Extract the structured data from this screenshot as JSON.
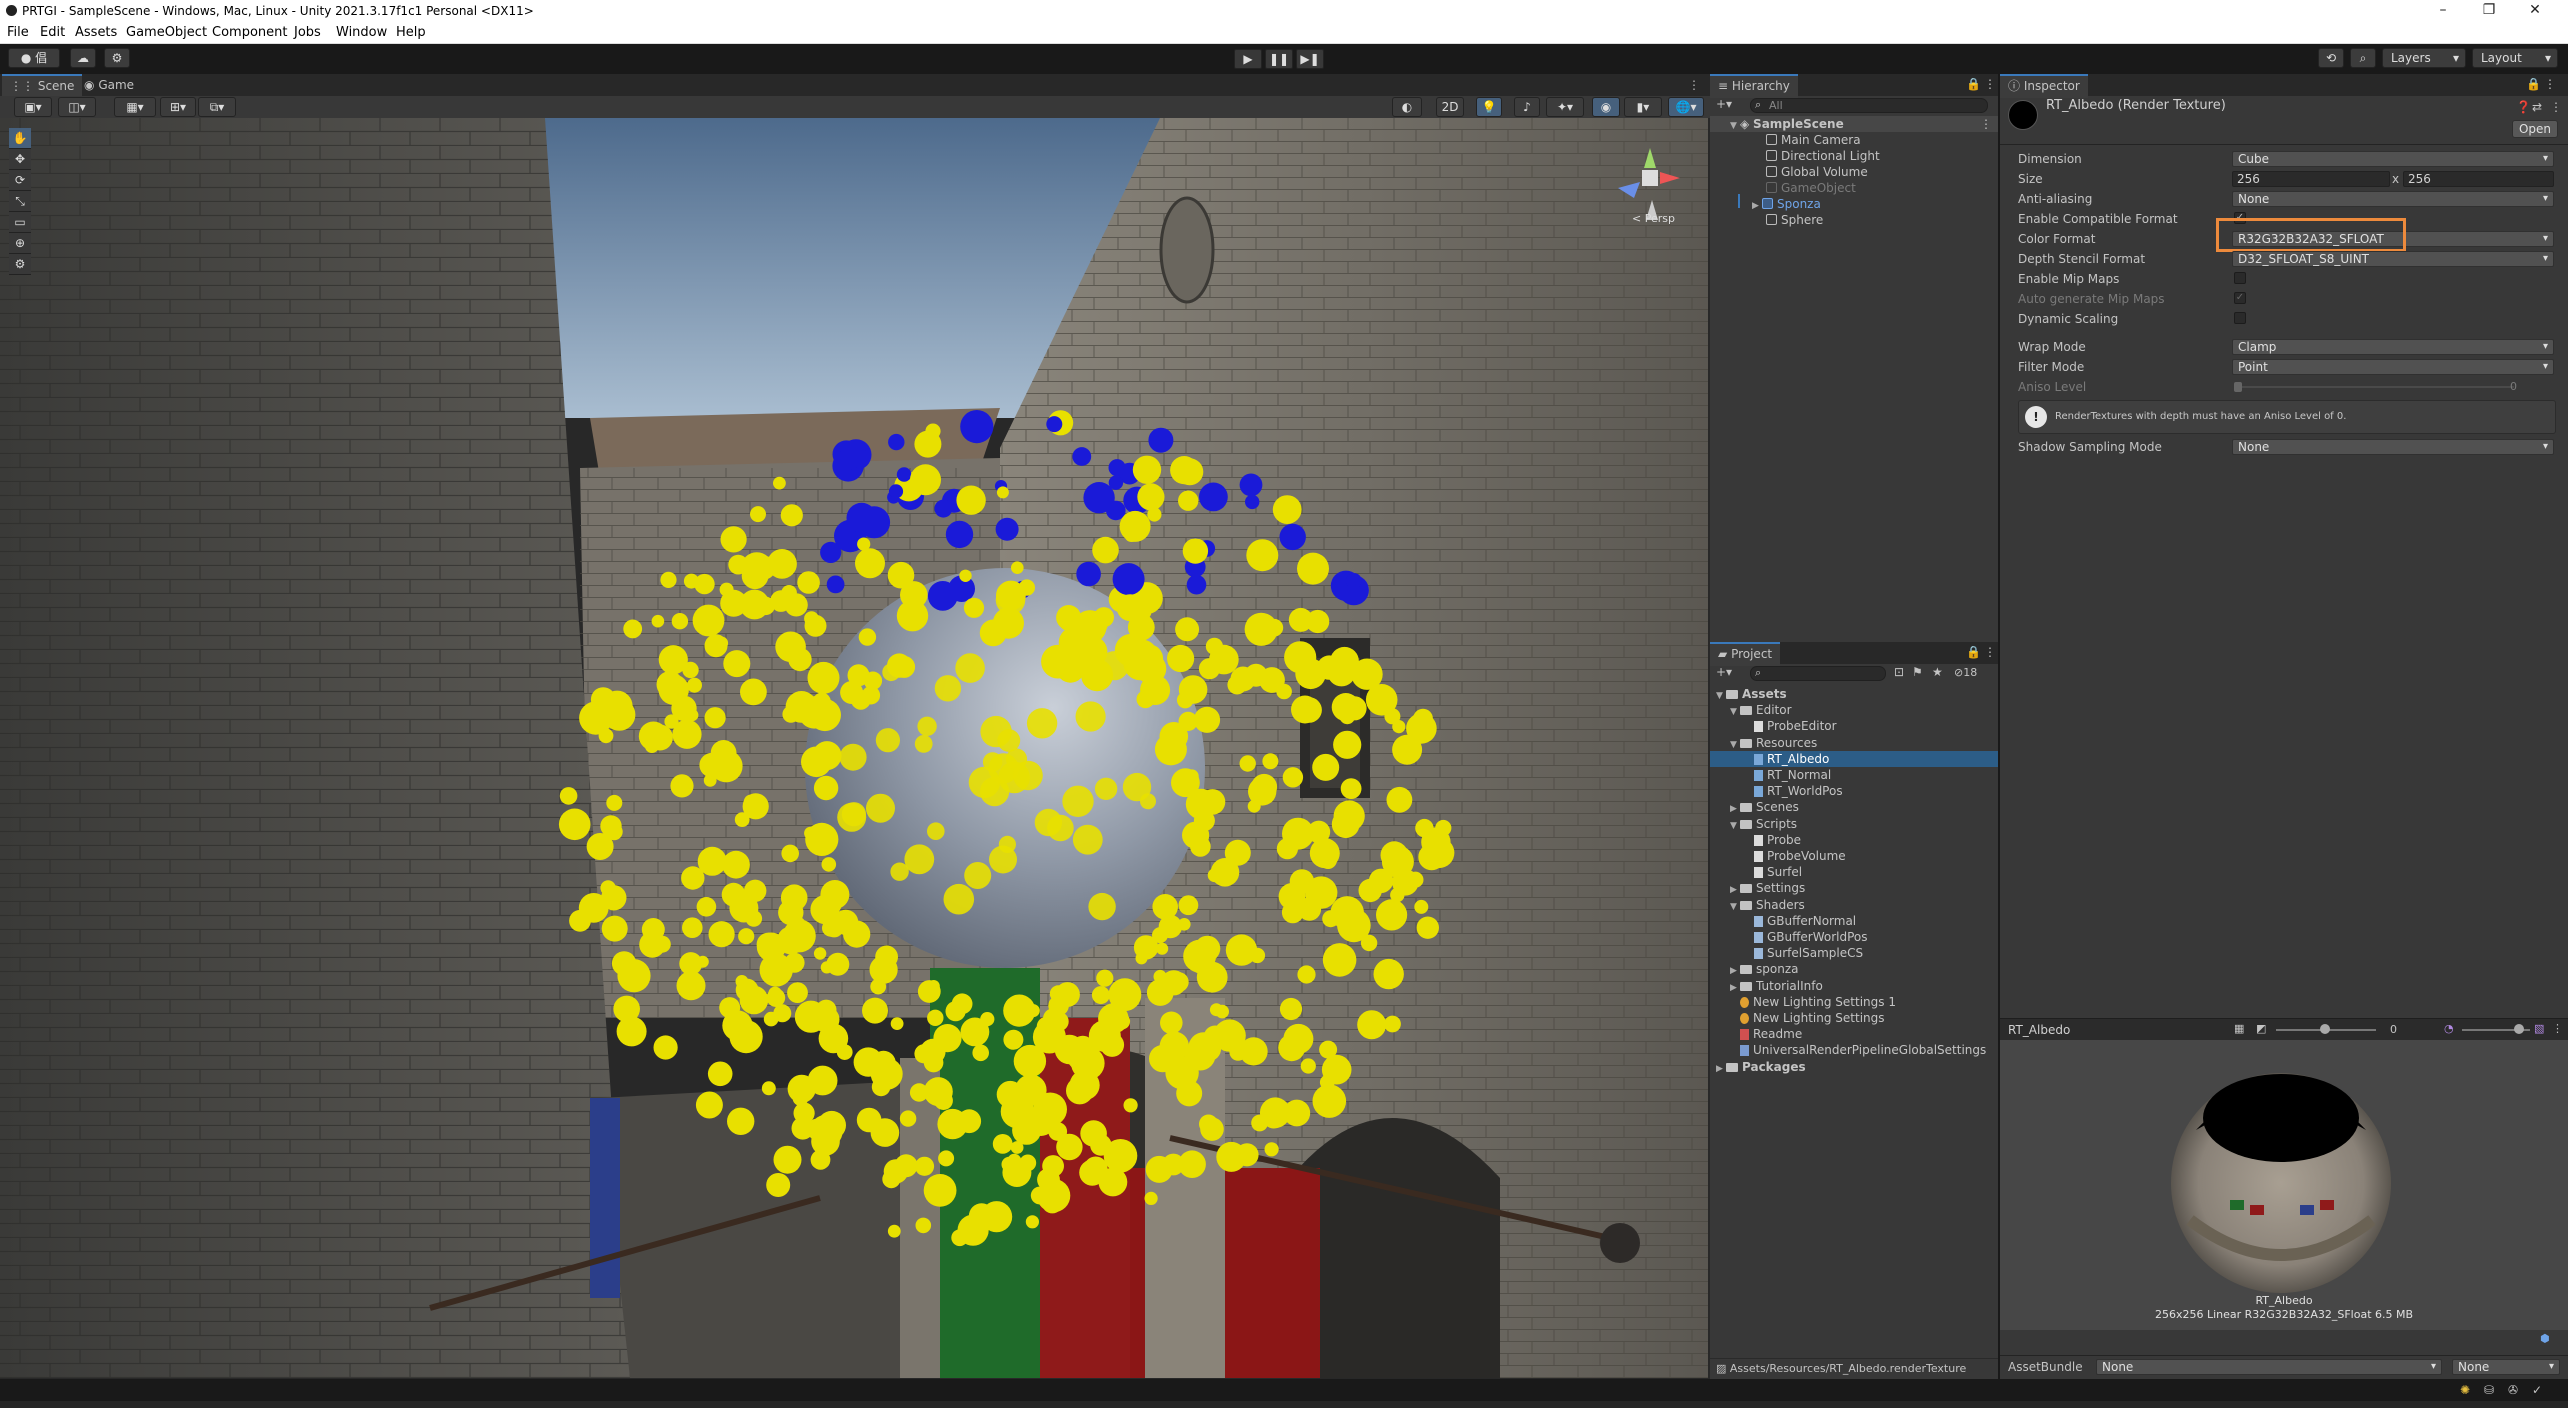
{
  "window": {
    "title": "PRTGI - SampleScene - Windows, Mac, Linux - Unity 2021.3.17f1c1 Personal <DX11>",
    "controls": [
      "–",
      "❐",
      "✕"
    ]
  },
  "menu": [
    "File",
    "Edit",
    "Assets",
    "GameObject",
    "Component",
    "Jobs",
    "Window",
    "Help"
  ],
  "toolbar": {
    "account_label": "倡",
    "layers_label": "Layers",
    "layout_label": "Layout",
    "play_icon": "▶",
    "pause_icon": "❚❚",
    "step_icon": "▶❚"
  },
  "scene": {
    "tabs": [
      "Scene",
      "Game"
    ],
    "toggle_2d": "2D",
    "gizmo_label": "< Persp",
    "gizmo_axes": {
      "y": "y",
      "x": "x",
      "z": "z"
    }
  },
  "hierarchy": {
    "tab": "Hierarchy",
    "search_placeholder": "All",
    "root": "SampleScene",
    "items": [
      {
        "label": "Main Camera",
        "disabled": false
      },
      {
        "label": "Directional Light",
        "disabled": false
      },
      {
        "label": "Global Volume",
        "disabled": false
      },
      {
        "label": "GameObject",
        "disabled": true
      },
      {
        "label": "Sponza",
        "prefab": true
      },
      {
        "label": "Sphere",
        "disabled": false
      }
    ]
  },
  "project": {
    "tab": "Project",
    "badge_count": "18",
    "tree": [
      {
        "label": "Assets",
        "depth": 0,
        "type": "folder",
        "bold": true
      },
      {
        "label": "Editor",
        "depth": 1,
        "type": "folder"
      },
      {
        "label": "ProbeEditor",
        "depth": 2,
        "type": "script"
      },
      {
        "label": "Resources",
        "depth": 1,
        "type": "folder"
      },
      {
        "label": "RT_Albedo",
        "depth": 2,
        "type": "rt",
        "selected": true
      },
      {
        "label": "RT_Normal",
        "depth": 2,
        "type": "rt"
      },
      {
        "label": "RT_WorldPos",
        "depth": 2,
        "type": "rt"
      },
      {
        "label": "Scenes",
        "depth": 1,
        "type": "folder"
      },
      {
        "label": "Scripts",
        "depth": 1,
        "type": "folder"
      },
      {
        "label": "Probe",
        "depth": 2,
        "type": "script"
      },
      {
        "label": "ProbeVolume",
        "depth": 2,
        "type": "script"
      },
      {
        "label": "Surfel",
        "depth": 2,
        "type": "script"
      },
      {
        "label": "Settings",
        "depth": 1,
        "type": "folder"
      },
      {
        "label": "Shaders",
        "depth": 1,
        "type": "folder"
      },
      {
        "label": "GBufferNormal",
        "depth": 2,
        "type": "shader"
      },
      {
        "label": "GBufferWorldPos",
        "depth": 2,
        "type": "shader"
      },
      {
        "label": "SurfelSampleCS",
        "depth": 2,
        "type": "shader"
      },
      {
        "label": "sponza",
        "depth": 1,
        "type": "folder"
      },
      {
        "label": "TutorialInfo",
        "depth": 1,
        "type": "folder"
      },
      {
        "label": "New Lighting Settings 1",
        "depth": 1,
        "type": "light"
      },
      {
        "label": "New Lighting Settings",
        "depth": 1,
        "type": "light"
      },
      {
        "label": "Readme",
        "depth": 1,
        "type": "readme"
      },
      {
        "label": "UniversalRenderPipelineGlobalSettings",
        "depth": 1,
        "type": "asset"
      },
      {
        "label": "Packages",
        "depth": 0,
        "type": "folder",
        "bold": true
      }
    ],
    "path": "Assets/Resources/RT_Albedo.renderTexture"
  },
  "inspector": {
    "tab": "Inspector",
    "asset_title": "RT_Albedo (Render Texture)",
    "open_button": "Open",
    "fields": {
      "dimension": {
        "label": "Dimension",
        "value": "Cube"
      },
      "size": {
        "label": "Size",
        "w": "256",
        "x": "x",
        "h": "256"
      },
      "anti_aliasing": {
        "label": "Anti-aliasing",
        "value": "None"
      },
      "compatible": {
        "label": "Enable Compatible Format"
      },
      "color_format": {
        "label": "Color Format",
        "value": "R32G32B32A32_SFLOAT"
      },
      "depth_format": {
        "label": "Depth Stencil Format",
        "value": "D32_SFLOAT_S8_UINT"
      },
      "mipmaps": {
        "label": "Enable Mip Maps"
      },
      "auto_mips": {
        "label": "Auto generate Mip Maps"
      },
      "dynamic_scaling": {
        "label": "Dynamic Scaling"
      },
      "wrap_mode": {
        "label": "Wrap Mode",
        "value": "Clamp"
      },
      "filter_mode": {
        "label": "Filter Mode",
        "value": "Point"
      },
      "aniso": {
        "label": "Aniso Level",
        "value": "0"
      },
      "warning": "RenderTextures with depth must have an Aniso Level of 0.",
      "shadow_mode": {
        "label": "Shadow Sampling Mode",
        "value": "None"
      }
    },
    "preview": {
      "name": "RT_Albedo",
      "mip_value": "0",
      "caption_name": "RT_Albedo",
      "caption_info": "256x256 Linear  R32G32B32A32_SFloat  6.5 MB"
    },
    "assetbundle": {
      "label": "AssetBundle",
      "value": "None",
      "variant": "None"
    }
  },
  "colors": {
    "accent": "#3a79bb",
    "highlight": "#ed8a3c",
    "probe_yellow": "#e8e000",
    "probe_blue": "#1a1ad8"
  }
}
